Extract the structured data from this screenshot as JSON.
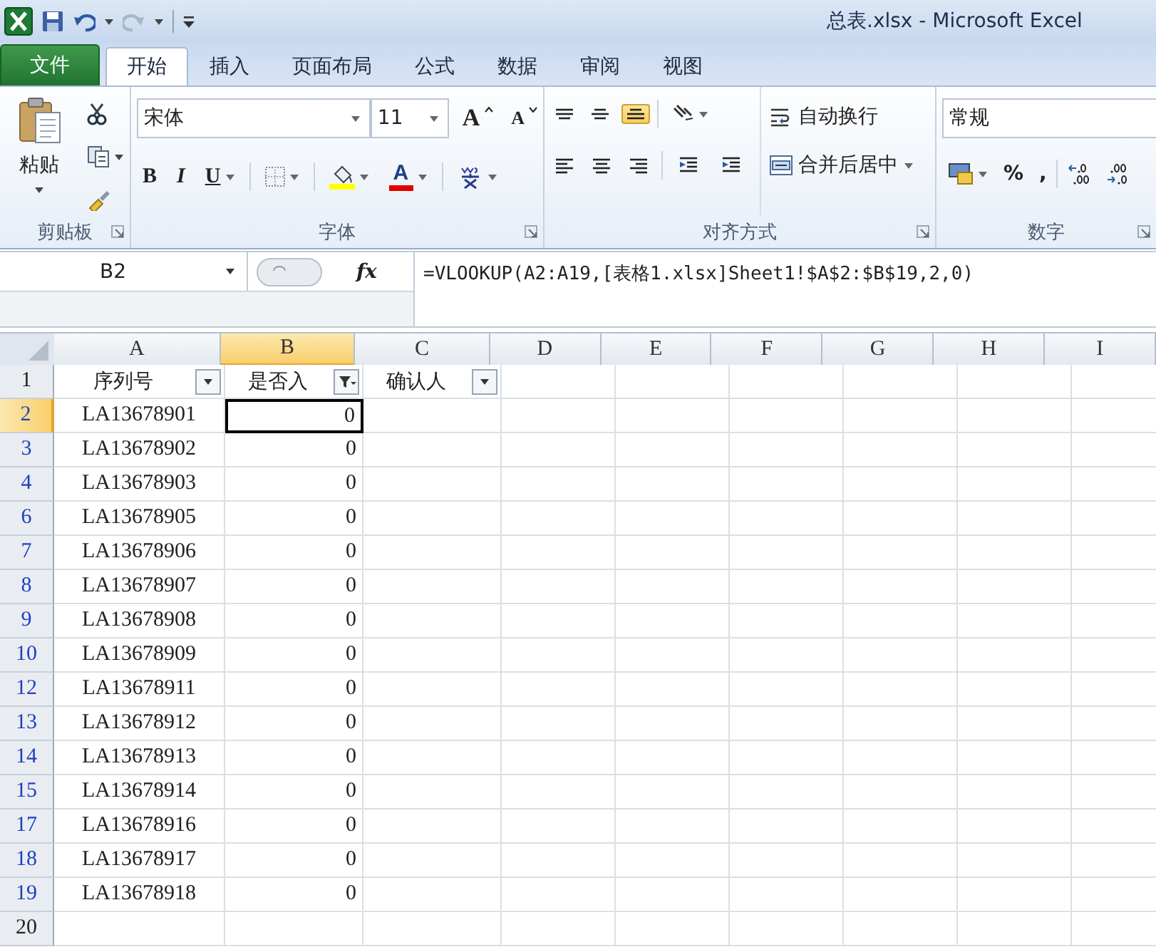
{
  "title_bar": {
    "title": "总表.xlsx - Microsoft Excel"
  },
  "ribbon_tabs": [
    {
      "label": "文件",
      "kind": "file",
      "selected": false
    },
    {
      "label": "开始",
      "kind": "tab",
      "selected": true
    },
    {
      "label": "插入",
      "kind": "tab",
      "selected": false
    },
    {
      "label": "页面布局",
      "kind": "tab",
      "selected": false
    },
    {
      "label": "公式",
      "kind": "tab",
      "selected": false
    },
    {
      "label": "数据",
      "kind": "tab",
      "selected": false
    },
    {
      "label": "审阅",
      "kind": "tab",
      "selected": false
    },
    {
      "label": "视图",
      "kind": "tab",
      "selected": false
    }
  ],
  "ribbon": {
    "clipboard": {
      "paste": "粘贴",
      "label": "剪贴板"
    },
    "font": {
      "name": "宋体",
      "size": "11",
      "grow": "A",
      "shrink": "A",
      "bold": "B",
      "italic": "I",
      "underline": "U",
      "font_color_glyph": "A",
      "label": "字体"
    },
    "alignment": {
      "bottom_align_on": true,
      "wrap": "自动换行",
      "merge": "合并后居中",
      "label": "对齐方式"
    },
    "number": {
      "format": "常规",
      "percent": "%",
      "comma": ",",
      "label": "数字"
    }
  },
  "formula_bar": {
    "name_box": "B2",
    "fx": "fx",
    "formula": "=VLOOKUP(A2:A19,[表格1.xlsx]Sheet1!$A$2:$B$19,2,0)"
  },
  "sheet": {
    "columns": [
      {
        "label": "A",
        "selected": false
      },
      {
        "label": "B",
        "selected": true
      },
      {
        "label": "C",
        "selected": false
      },
      {
        "label": "D",
        "selected": false
      },
      {
        "label": "E",
        "selected": false
      },
      {
        "label": "F",
        "selected": false
      },
      {
        "label": "G",
        "selected": false
      },
      {
        "label": "H",
        "selected": false
      },
      {
        "label": "I",
        "selected": false
      }
    ],
    "rows": [
      {
        "number": "1",
        "kind": "header",
        "filtered": false,
        "selected": false,
        "cells": [
          {
            "text": "序列号",
            "filtered": false,
            "selected": false
          },
          {
            "text": "是否入",
            "filtered": true,
            "selected": false
          },
          {
            "text": "确认人",
            "filtered": false,
            "selected": false
          }
        ]
      },
      {
        "number": "2",
        "filtered": true,
        "selected": true,
        "cells": [
          {
            "text": "LA13678901",
            "selected": false
          },
          {
            "text": "0",
            "selected": true
          }
        ]
      },
      {
        "number": "3",
        "filtered": true,
        "selected": false,
        "cells": [
          {
            "text": "LA13678902",
            "selected": false
          },
          {
            "text": "0",
            "selected": false
          }
        ]
      },
      {
        "number": "4",
        "filtered": true,
        "selected": false,
        "cells": [
          {
            "text": "LA13678903",
            "selected": false
          },
          {
            "text": "0",
            "selected": false
          }
        ]
      },
      {
        "number": "6",
        "filtered": true,
        "selected": false,
        "cells": [
          {
            "text": "LA13678905",
            "selected": false
          },
          {
            "text": "0",
            "selected": false
          }
        ]
      },
      {
        "number": "7",
        "filtered": true,
        "selected": false,
        "cells": [
          {
            "text": "LA13678906",
            "selected": false
          },
          {
            "text": "0",
            "selected": false
          }
        ]
      },
      {
        "number": "8",
        "filtered": true,
        "selected": false,
        "cells": [
          {
            "text": "LA13678907",
            "selected": false
          },
          {
            "text": "0",
            "selected": false
          }
        ]
      },
      {
        "number": "9",
        "filtered": true,
        "selected": false,
        "cells": [
          {
            "text": "LA13678908",
            "selected": false
          },
          {
            "text": "0",
            "selected": false
          }
        ]
      },
      {
        "number": "10",
        "filtered": true,
        "selected": false,
        "cells": [
          {
            "text": "LA13678909",
            "selected": false
          },
          {
            "text": "0",
            "selected": false
          }
        ]
      },
      {
        "number": "12",
        "filtered": true,
        "selected": false,
        "cells": [
          {
            "text": "LA13678911",
            "selected": false
          },
          {
            "text": "0",
            "selected": false
          }
        ]
      },
      {
        "number": "13",
        "filtered": true,
        "selected": false,
        "cells": [
          {
            "text": "LA13678912",
            "selected": false
          },
          {
            "text": "0",
            "selected": false
          }
        ]
      },
      {
        "number": "14",
        "filtered": true,
        "selected": false,
        "cells": [
          {
            "text": "LA13678913",
            "selected": false
          },
          {
            "text": "0",
            "selected": false
          }
        ]
      },
      {
        "number": "15",
        "filtered": true,
        "selected": false,
        "cells": [
          {
            "text": "LA13678914",
            "selected": false
          },
          {
            "text": "0",
            "selected": false
          }
        ]
      },
      {
        "number": "17",
        "filtered": true,
        "selected": false,
        "cells": [
          {
            "text": "LA13678916",
            "selected": false
          },
          {
            "text": "0",
            "selected": false
          }
        ]
      },
      {
        "number": "18",
        "filtered": true,
        "selected": false,
        "cells": [
          {
            "text": "LA13678917",
            "selected": false
          },
          {
            "text": "0",
            "selected": false
          }
        ]
      },
      {
        "number": "19",
        "filtered": true,
        "selected": false,
        "cells": [
          {
            "text": "LA13678918",
            "selected": false
          },
          {
            "text": "0",
            "selected": false
          }
        ]
      },
      {
        "number": "20",
        "filtered": false,
        "selected": false,
        "cells": []
      }
    ]
  }
}
